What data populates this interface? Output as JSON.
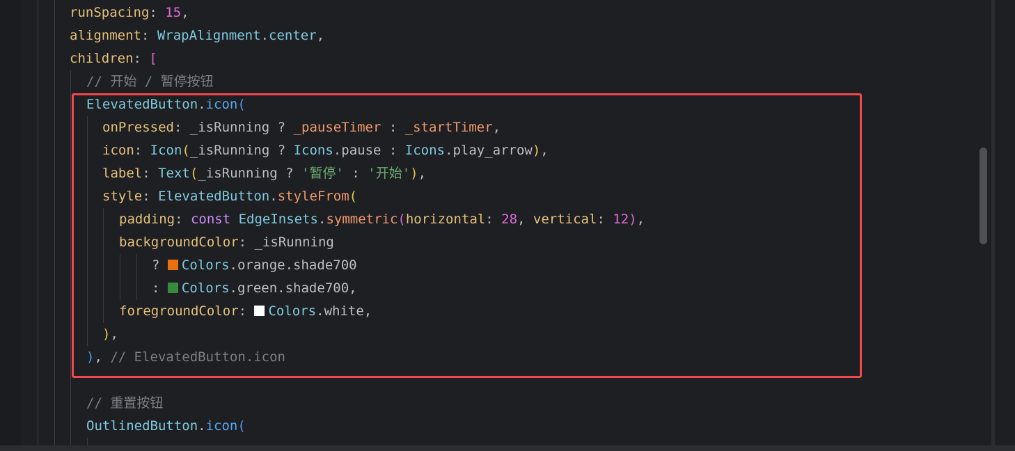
{
  "editor": {
    "lines": {
      "l1": {
        "prop": "runSpacing",
        "colon": ": ",
        "num": "15",
        "end": ","
      },
      "l2": {
        "prop": "alignment",
        "colon": ": ",
        "cls": "WrapAlignment",
        "dot": ".",
        "member": "center",
        "end": ","
      },
      "l3": {
        "prop": "children",
        "colon": ": ",
        "br": "["
      },
      "l4": {
        "comment": "// 开始 / 暂停按钮"
      },
      "l5": {
        "cls": "ElevatedButton",
        "dot": ".",
        "fn": "icon",
        "br": "("
      },
      "l6": {
        "prop": "onPressed",
        "colon": ": ",
        "v1": "_isRunning",
        " q": " ? ",
        "c1": "_pauseTimer",
        "sep": " : ",
        "c2": "_startTimer",
        "end": ","
      },
      "l7": {
        "prop": "icon",
        "colon": ": ",
        "cls": "Icon",
        "br": "(",
        "v1": "_isRunning",
        "q": " ? ",
        "cls2": "Icons",
        "dot": ".",
        "m1": "pause",
        "sep": " : ",
        "cls3": "Icons",
        "dot2": ".",
        "m2": "play_arrow",
        "brc": ")",
        "end": ","
      },
      "l8": {
        "prop": "label",
        "colon": ": ",
        "cls": "Text",
        "br": "(",
        "v1": "_isRunning",
        "q": " ? ",
        "s1": "'暂停'",
        "sep": " : ",
        "s2": "'开始'",
        "brc": ")",
        "end": ","
      },
      "l9": {
        "prop": "style",
        "colon": ": ",
        "cls": "ElevatedButton",
        "dot": ".",
        "call": "styleFrom",
        "br": "("
      },
      "l10": {
        "prop": "padding",
        "colon": ": ",
        "kw": "const ",
        "cls": "EdgeInsets",
        "dot": ".",
        "call": "symmetric",
        "br": "(",
        "p1": "horizontal",
        "colon2": ": ",
        "n1": "28",
        "comma": ", ",
        "p2": "vertical",
        "colon3": ": ",
        "n2": "12",
        "brc": ")",
        "end": ","
      },
      "l11": {
        "prop": "backgroundColor",
        "colon": ": ",
        "v1": "_isRunning"
      },
      "l12": {
        "q": "? ",
        "cls": "Colors",
        "dot": ".",
        "m": "orange.shade700"
      },
      "l13": {
        "q": ": ",
        "cls": "Colors",
        "dot": ".",
        "m": "green.shade700",
        "end": ","
      },
      "l14": {
        "prop": "foregroundColor",
        "colon": ": ",
        "cls": "Colors",
        "dot": ".",
        "m": "white",
        "end": ","
      },
      "l15": {
        "brc": ")",
        "end": ","
      },
      "l16": {
        "brc": ")",
        "end": ", ",
        "comment": "// ElevatedButton.icon"
      },
      "l17": {
        "comment": "// 重置按钮"
      },
      "l18": {
        "cls": "OutlinedButton",
        "dot": ".",
        "fn": "icon",
        "br": "("
      }
    },
    "swatches": {
      "orange": "#e8700f",
      "green": "#3a8a3e",
      "white": "#ffffff"
    },
    "highlight_color": "#f0484d"
  }
}
